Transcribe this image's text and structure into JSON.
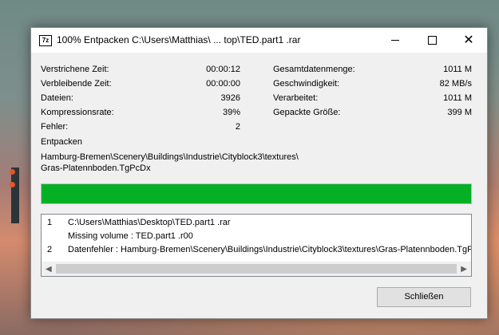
{
  "window": {
    "app_icon_text": "7z",
    "title": "100% Entpacken C:\\Users\\Matthias\\ ... top\\TED.part1 .rar"
  },
  "stats_left": [
    {
      "label": "Verstrichene Zeit:",
      "value": "00:00:12"
    },
    {
      "label": "Verbleibende Zeit:",
      "value": "00:00:00"
    },
    {
      "label": "Dateien:",
      "value": "3926"
    },
    {
      "label": "Kompressionsrate:",
      "value": "39%"
    },
    {
      "label": "Fehler:",
      "value": "2"
    }
  ],
  "stats_right": [
    {
      "label": "Gesamtdatenmenge:",
      "value": "1011 M"
    },
    {
      "label": "Geschwindigkeit:",
      "value": "82 MB/s"
    },
    {
      "label": "Verarbeitet:",
      "value": "1011 M"
    },
    {
      "label": "Gepackte Größe:",
      "value": "399 M"
    }
  ],
  "operation": {
    "label": "Entpacken",
    "path_line1": "Hamburg-Bremen\\Scenery\\Buildings\\Industrie\\Cityblock3\\textures\\",
    "path_line2": "Gras-Platennboden.TgPcDx"
  },
  "progress": {
    "percent": 100,
    "color": "#06b025"
  },
  "log": [
    {
      "num": "1",
      "text": "C:\\Users\\Matthias\\Desktop\\TED.part1 .rar"
    },
    {
      "num": "",
      "text": "Missing volume : TED.part1 .r00"
    },
    {
      "num": "2",
      "text": "Datenfehler : Hamburg-Bremen\\Scenery\\Buildings\\Industrie\\Cityblock3\\textures\\Gras-Platennboden.TgPcI"
    }
  ],
  "buttons": {
    "close": "Schließen"
  }
}
